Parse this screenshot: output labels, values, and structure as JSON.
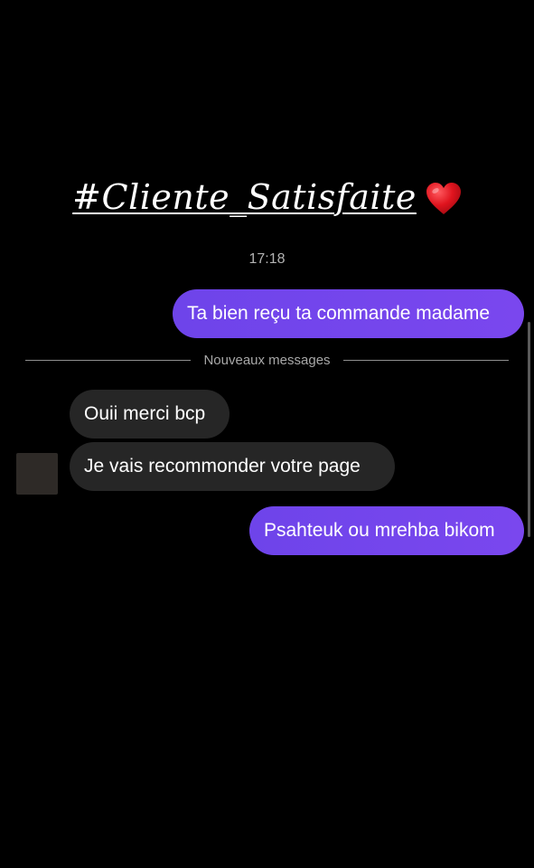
{
  "story": {
    "caption": "#Cliente_Satisfaite",
    "caption_emoji": "heart-icon"
  },
  "chat": {
    "timestamp": "17:18",
    "divider_label": "Nouveaux messages",
    "messages": [
      {
        "direction": "outgoing",
        "text": "Ta bien reçu ta commande madame"
      },
      {
        "direction": "incoming",
        "text": "Ouii merci bcp"
      },
      {
        "direction": "incoming",
        "text": "Je vais recommonder votre page"
      },
      {
        "direction": "outgoing",
        "text": "Psahteuk ou mrehba bikom"
      }
    ]
  },
  "colors": {
    "background": "#000000",
    "outgoing_bubble": "#7245e8",
    "incoming_bubble": "#262626",
    "text": "#ffffff",
    "muted_text": "#a8a8a8",
    "heart": "#e0141e"
  }
}
